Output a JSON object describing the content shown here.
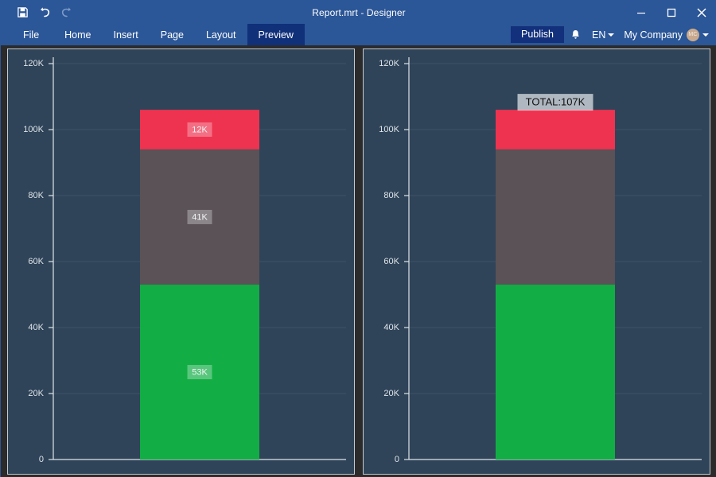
{
  "window": {
    "title": "Report.mrt - Designer",
    "quick_access": [
      {
        "name": "save-icon",
        "label": "Save",
        "state": "enabled"
      },
      {
        "name": "undo-icon",
        "label": "Undo",
        "state": "enabled"
      },
      {
        "name": "redo-icon",
        "label": "Redo",
        "state": "disabled"
      }
    ],
    "controls": [
      {
        "name": "minimize-button",
        "label": "Minimize"
      },
      {
        "name": "maximize-button",
        "label": "Maximize"
      },
      {
        "name": "close-button",
        "label": "Close"
      }
    ]
  },
  "menubar": {
    "items": [
      {
        "label": "File",
        "active": false
      },
      {
        "label": "Home",
        "active": false
      },
      {
        "label": "Insert",
        "active": false
      },
      {
        "label": "Page",
        "active": false
      },
      {
        "label": "Layout",
        "active": false
      },
      {
        "label": "Preview",
        "active": true
      }
    ],
    "publish_label": "Publish",
    "notifications_icon": "bell-icon",
    "language": "EN",
    "company": "My Company",
    "avatar_initials": "MC"
  },
  "colors": {
    "titlebar": "#2b5697",
    "menu_active": "#10307a",
    "publish": "#12307c",
    "page_background": "#2f4459",
    "workspace": "#2b2b2b",
    "series_green": "#12ae45",
    "series_gray": "#5a5256",
    "series_red": "#ee3350",
    "axis": "#dfe4ea",
    "gridline": "#3d5168"
  },
  "chart_data": [
    {
      "type": "bar",
      "title": "",
      "subtitle": "",
      "xlabel": "",
      "ylabel": "",
      "stacked": true,
      "grid": true,
      "legend": "none",
      "categories": [
        ""
      ],
      "ylim": [
        0,
        120000
      ],
      "ytick_labels": [
        "0",
        "20K",
        "40K",
        "60K",
        "80K",
        "100K",
        "120K"
      ],
      "ytick_values": [
        0,
        20000,
        40000,
        60000,
        80000,
        100000,
        120000
      ],
      "series": [
        {
          "name": "green",
          "color": "#12ae45",
          "values": [
            53000
          ],
          "data_labels": [
            "53K"
          ]
        },
        {
          "name": "gray",
          "color": "#5a5256",
          "values": [
            41000
          ],
          "data_labels": [
            "41K"
          ]
        },
        {
          "name": "red",
          "color": "#ee3350",
          "values": [
            12000
          ],
          "data_labels": [
            "12K"
          ]
        }
      ],
      "total_label": null
    },
    {
      "type": "bar",
      "title": "",
      "subtitle": "",
      "xlabel": "",
      "ylabel": "",
      "stacked": true,
      "grid": true,
      "legend": "none",
      "categories": [
        ""
      ],
      "ylim": [
        0,
        120000
      ],
      "ytick_labels": [
        "0",
        "20K",
        "40K",
        "60K",
        "80K",
        "100K",
        "120K"
      ],
      "ytick_values": [
        0,
        20000,
        40000,
        60000,
        80000,
        100000,
        120000
      ],
      "series": [
        {
          "name": "green",
          "color": "#12ae45",
          "values": [
            53000
          ],
          "data_labels": [
            ""
          ]
        },
        {
          "name": "gray",
          "color": "#5a5256",
          "values": [
            41000
          ],
          "data_labels": [
            ""
          ]
        },
        {
          "name": "red",
          "color": "#ee3350",
          "values": [
            12000
          ],
          "data_labels": [
            ""
          ]
        }
      ],
      "total_label": "TOTAL:107K"
    }
  ]
}
